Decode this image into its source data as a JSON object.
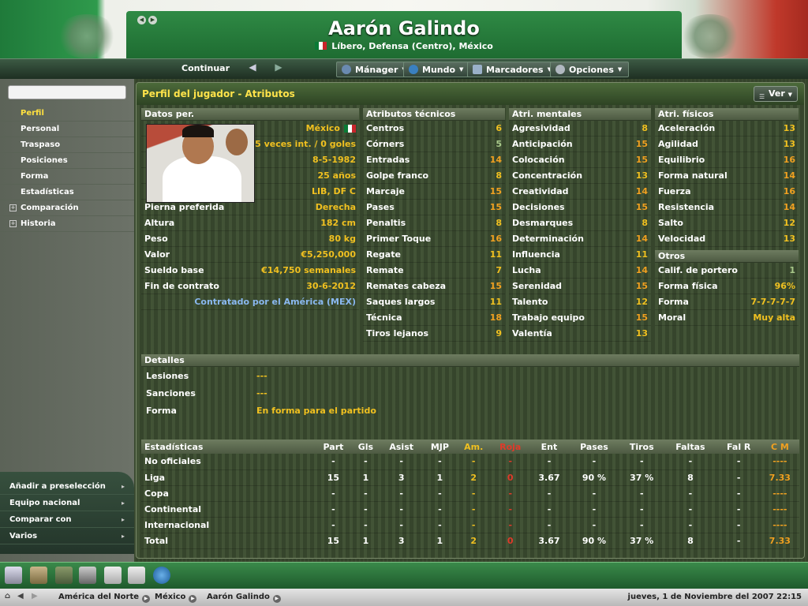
{
  "header": {
    "name": "Aarón Galindo",
    "subtitle": "Líbero, Defensa (Centro), México"
  },
  "toolbar": {
    "continue": "Continuar",
    "menus": [
      "Mánager",
      "Mundo",
      "Marcadores",
      "Opciones"
    ]
  },
  "sidebar": {
    "search_value": "",
    "items": [
      "Perfil",
      "Personal",
      "Traspaso",
      "Posiciones",
      "Forma",
      "Estadísticas",
      "Comparación",
      "Historia"
    ],
    "actions": [
      "Añadir a preselección",
      "Equipo nacional",
      "Comparar con",
      "Varios"
    ]
  },
  "panel": {
    "title": "Perfil del jugador - Atributos",
    "view_button": "Ver"
  },
  "personal": {
    "heading": "Datos per.",
    "nation": "México",
    "caps": "15 veces int. / 0 goles",
    "birth": "8-5-1982",
    "age": "25 años",
    "positions": "LIB, DF C",
    "rows": [
      {
        "label": "Pierna preferida",
        "value": "Derecha"
      },
      {
        "label": "Altura",
        "value": "182 cm"
      },
      {
        "label": "Peso",
        "value": "80 kg"
      },
      {
        "label": "Valor",
        "value": "€5,250,000"
      },
      {
        "label": "Sueldo base",
        "value": "€14,750 semanales"
      },
      {
        "label": "Fin de contrato",
        "value": "30-6-2012"
      }
    ],
    "contract_note": "Contratado por el América (MEX)"
  },
  "technical": {
    "heading": "Atributos técnicos",
    "rows": [
      {
        "label": "Centros",
        "value": "6"
      },
      {
        "label": "Córners",
        "value": "5"
      },
      {
        "label": "Entradas",
        "value": "14"
      },
      {
        "label": "Golpe franco",
        "value": "8"
      },
      {
        "label": "Marcaje",
        "value": "15"
      },
      {
        "label": "Pases",
        "value": "15"
      },
      {
        "label": "Penaltis",
        "value": "8"
      },
      {
        "label": "Primer Toque",
        "value": "16"
      },
      {
        "label": "Regate",
        "value": "11"
      },
      {
        "label": "Remate",
        "value": "7"
      },
      {
        "label": "Remates cabeza",
        "value": "15"
      },
      {
        "label": "Saques largos",
        "value": "11"
      },
      {
        "label": "Técnica",
        "value": "18"
      },
      {
        "label": "Tiros lejanos",
        "value": "9"
      }
    ]
  },
  "mental": {
    "heading": "Atri. mentales",
    "rows": [
      {
        "label": "Agresividad",
        "value": "8"
      },
      {
        "label": "Anticipación",
        "value": "15"
      },
      {
        "label": "Colocación",
        "value": "15"
      },
      {
        "label": "Concentración",
        "value": "13"
      },
      {
        "label": "Creatividad",
        "value": "14"
      },
      {
        "label": "Decisiones",
        "value": "15"
      },
      {
        "label": "Desmarques",
        "value": "8"
      },
      {
        "label": "Determinación",
        "value": "14"
      },
      {
        "label": "Influencia",
        "value": "11"
      },
      {
        "label": "Lucha",
        "value": "14"
      },
      {
        "label": "Serenidad",
        "value": "15"
      },
      {
        "label": "Talento",
        "value": "12"
      },
      {
        "label": "Trabajo equipo",
        "value": "15"
      },
      {
        "label": "Valentía",
        "value": "13"
      }
    ]
  },
  "physical": {
    "heading": "Atri. físicos",
    "rows": [
      {
        "label": "Aceleración",
        "value": "13"
      },
      {
        "label": "Agilidad",
        "value": "13"
      },
      {
        "label": "Equilibrio",
        "value": "16"
      },
      {
        "label": "Forma natural",
        "value": "14"
      },
      {
        "label": "Fuerza",
        "value": "16"
      },
      {
        "label": "Resistencia",
        "value": "14"
      },
      {
        "label": "Salto",
        "value": "12"
      },
      {
        "label": "Velocidad",
        "value": "13"
      }
    ]
  },
  "others": {
    "heading": "Otros",
    "rows": [
      {
        "label": "Calif. de portero",
        "value": "1"
      },
      {
        "label": "Forma física",
        "value": "96%"
      },
      {
        "label": "Forma",
        "value": "7-7-7-7-7"
      },
      {
        "label": "Moral",
        "value": "Muy alta"
      }
    ]
  },
  "details": {
    "heading": "Detalles",
    "rows": [
      {
        "label": "Lesiones",
        "value": "---"
      },
      {
        "label": "Sanciones",
        "value": "---"
      },
      {
        "label": "Forma",
        "value": "En forma para el partido"
      }
    ]
  },
  "stats": {
    "columns": [
      "Estadísticas",
      "Part",
      "Gls",
      "Asist",
      "MJP",
      "Am.",
      "Roja",
      "Ent",
      "Pases",
      "Tiros",
      "Faltas",
      "Fal R",
      "C M"
    ],
    "rows": [
      [
        "No oficiales",
        "-",
        "-",
        "-",
        "-",
        "-",
        "-",
        "-",
        "-",
        "-",
        "-",
        "-",
        "----"
      ],
      [
        "Liga",
        "15",
        "1",
        "3",
        "1",
        "2",
        "0",
        "3.67",
        "90 %",
        "37 %",
        "8",
        "-",
        "7.33"
      ],
      [
        "Copa",
        "-",
        "-",
        "-",
        "-",
        "-",
        "-",
        "-",
        "-",
        "-",
        "-",
        "-",
        "----"
      ],
      [
        "Continental",
        "-",
        "-",
        "-",
        "-",
        "-",
        "-",
        "-",
        "-",
        "-",
        "-",
        "-",
        "----"
      ],
      [
        "Internacional",
        "-",
        "-",
        "-",
        "-",
        "-",
        "-",
        "-",
        "-",
        "-",
        "-",
        "-",
        "----"
      ],
      [
        "Total",
        "15",
        "1",
        "3",
        "1",
        "2",
        "0",
        "3.67",
        "90 %",
        "37 %",
        "8",
        "-",
        "7.33"
      ]
    ]
  },
  "bottom_icons": [
    "home-icon",
    "notebook-icon",
    "team-icon",
    "stack-icon",
    "clipboard-icon",
    "clipboard-check-icon",
    "globe-icon"
  ],
  "status": {
    "breadcrumbs": [
      "América del Norte",
      "México",
      "Aarón Galindo"
    ],
    "datetime": "jueves, 1 de Noviembre del 2007 22:15"
  },
  "colors": {
    "accent_yellow": "#f0c020",
    "red": "#e03a2a",
    "orange": "#f0a020",
    "green": "#1f7a3a"
  }
}
